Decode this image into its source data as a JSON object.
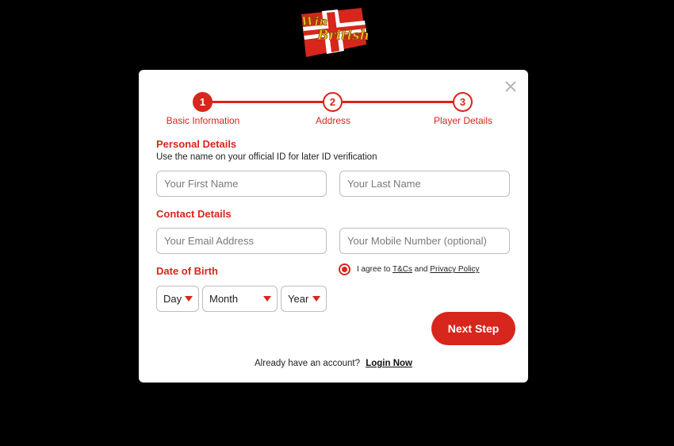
{
  "brand": {
    "logo_line1": "Win",
    "logo_line2": "British",
    "accent_color": "#d7261c",
    "gold_color": "#f2b21a"
  },
  "modal": {
    "close_icon": "close-icon"
  },
  "stepper": {
    "steps": [
      {
        "number": "1",
        "label": "Basic Information"
      },
      {
        "number": "2",
        "label": "Address"
      },
      {
        "number": "3",
        "label": "Player Details"
      }
    ],
    "active_step": 1
  },
  "personal": {
    "title": "Personal Details",
    "helper": "Use the name on your official ID for later ID verification",
    "first_name_placeholder": "Your First Name",
    "first_name_value": "",
    "last_name_placeholder": "Your Last Name",
    "last_name_value": ""
  },
  "contact": {
    "title": "Contact Details",
    "email_placeholder": "Your Email Address",
    "email_value": "",
    "mobile_placeholder": "Your Mobile Number (optional)",
    "mobile_value": ""
  },
  "dob": {
    "title": "Date of Birth",
    "day_label": "Day",
    "month_label": "Month",
    "year_label": "Year"
  },
  "agreement": {
    "prefix": "I agree to ",
    "terms_link": "T&Cs",
    "middle": " and ",
    "privacy_link": "Privacy Policy"
  },
  "actions": {
    "next_label": "Next Step"
  },
  "footer": {
    "prompt": "Already have an account?",
    "login_link": "Login Now"
  }
}
